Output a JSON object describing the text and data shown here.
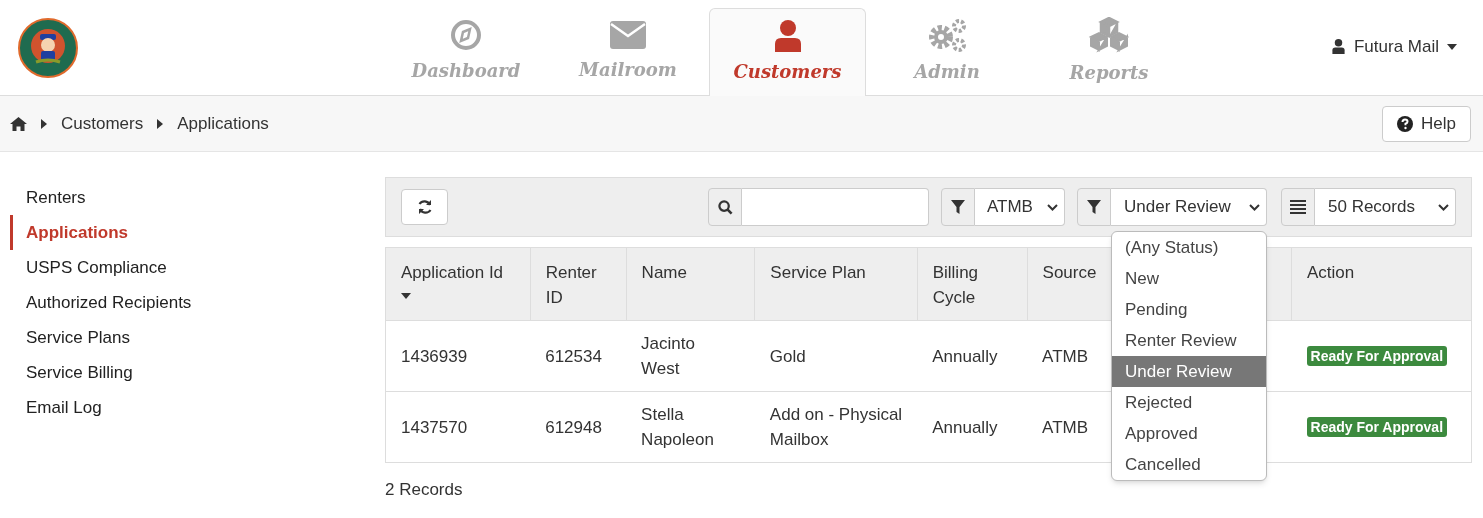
{
  "nav": {
    "tabs": [
      {
        "label": "Dashboard",
        "selected": false
      },
      {
        "label": "Mailroom",
        "selected": false
      },
      {
        "label": "Customers",
        "selected": true
      },
      {
        "label": "Admin",
        "selected": false
      },
      {
        "label": "Reports",
        "selected": false
      }
    ],
    "user_menu": {
      "label": "Futura Mail"
    }
  },
  "breadcrumb": [
    "Customers",
    "Applications"
  ],
  "help_button": "Help",
  "sidebar": {
    "items": [
      {
        "label": "Renters",
        "selected": false
      },
      {
        "label": "Applications",
        "selected": true
      },
      {
        "label": "USPS Compliance",
        "selected": false
      },
      {
        "label": "Authorized Recipients",
        "selected": false
      },
      {
        "label": "Service Plans",
        "selected": false
      },
      {
        "label": "Service Billing",
        "selected": false
      },
      {
        "label": "Email Log",
        "selected": false
      }
    ]
  },
  "toolbar": {
    "source_filter": "ATMB",
    "status_filter": "Under Review",
    "page_size": "50 Records",
    "status_options": [
      {
        "label": "(Any Status)",
        "selected": false
      },
      {
        "label": "New",
        "selected": false
      },
      {
        "label": "Pending",
        "selected": false
      },
      {
        "label": "Renter Review",
        "selected": false
      },
      {
        "label": "Under Review",
        "selected": true
      },
      {
        "label": "Rejected",
        "selected": false
      },
      {
        "label": "Approved",
        "selected": false
      },
      {
        "label": "Cancelled",
        "selected": false
      }
    ]
  },
  "table": {
    "columns": [
      {
        "label": "Application Id",
        "sorted": true
      },
      {
        "label": "Renter ID",
        "sorted": false
      },
      {
        "label": "Name",
        "sorted": false
      },
      {
        "label": "Service Plan",
        "sorted": false
      },
      {
        "label": "Billing Cycle",
        "sorted": false
      },
      {
        "label": "Source",
        "sorted": false
      },
      {
        "sorted": false
      },
      {
        "label": "Action",
        "sorted": false
      }
    ],
    "rows": [
      {
        "cells": [
          "1436939",
          "612534",
          "Jacinto West",
          "Gold",
          "Annually",
          "ATMB",
          null,
          "Ready For Approval"
        ]
      },
      {
        "cells": [
          "1437570",
          "612948",
          "Stella Napoleon",
          "Add on - Physical Mailbox",
          "Annually",
          "ATMB",
          null,
          "Ready For Approval"
        ]
      }
    ]
  },
  "record_count": "2 Records"
}
